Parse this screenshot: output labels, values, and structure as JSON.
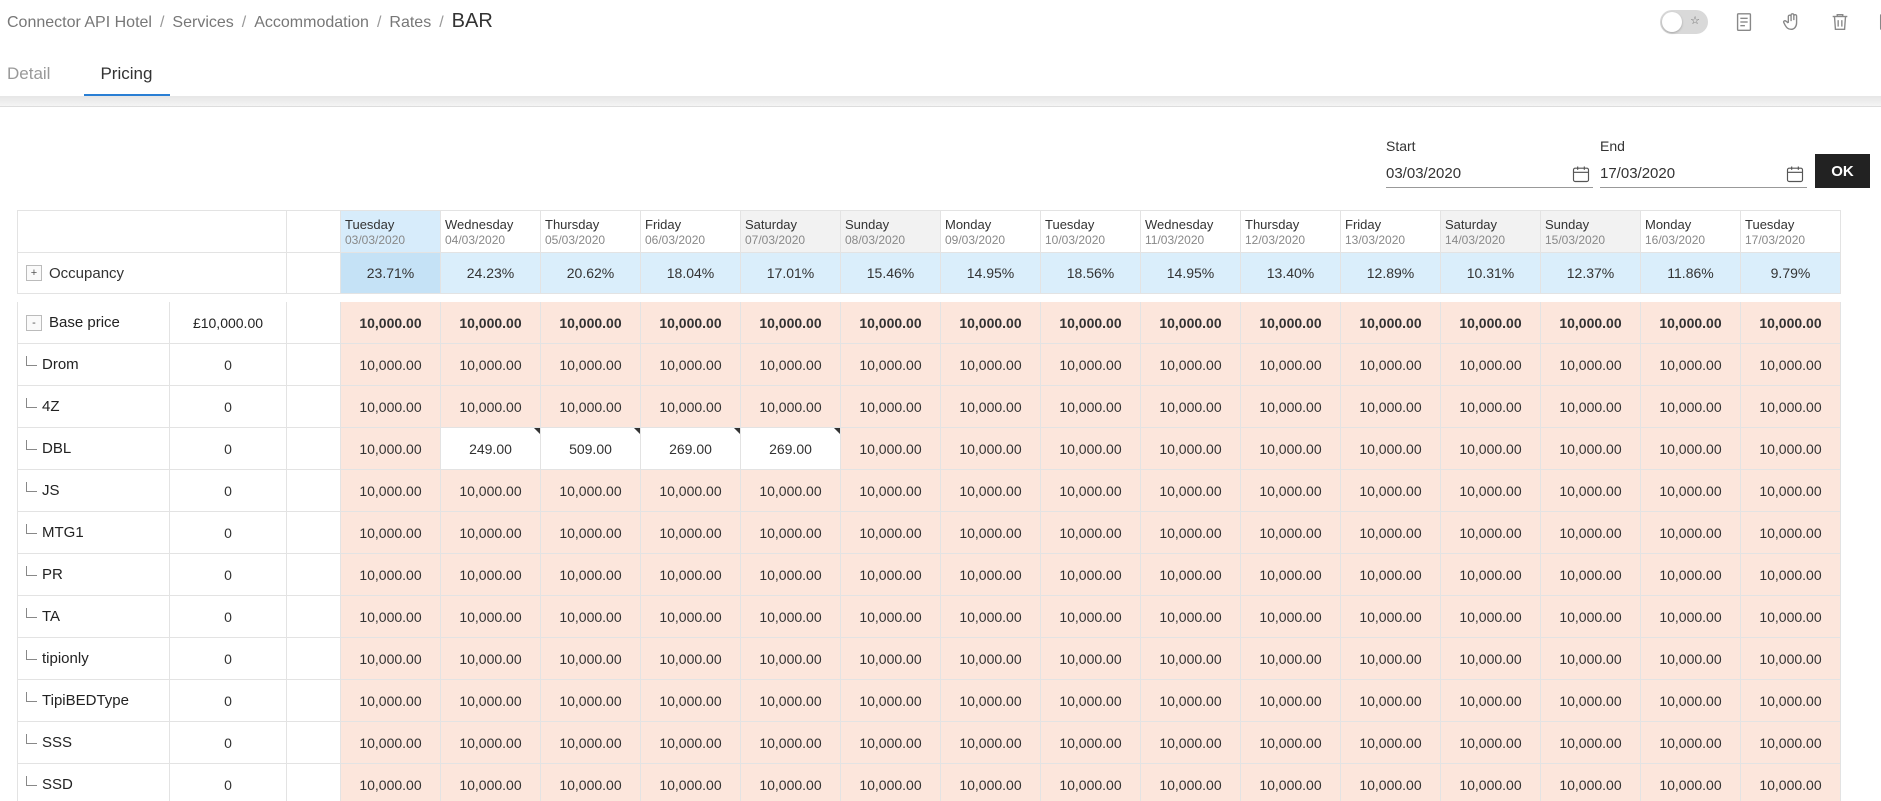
{
  "breadcrumb": {
    "items": [
      "Connector API Hotel",
      "Services",
      "Accommodation",
      "Rates"
    ],
    "current": "BAR"
  },
  "toolbar": {
    "toggle_icon": "star-icon",
    "icons": [
      "report-icon",
      "hand-icon",
      "trash-icon",
      "export-icon"
    ]
  },
  "tabs": [
    {
      "label": "Detail",
      "active": false
    },
    {
      "label": "Pricing",
      "active": true
    }
  ],
  "date_range": {
    "start_label": "Start",
    "start_value": "03/03/2020",
    "end_label": "End",
    "end_value": "17/03/2020",
    "ok_label": "OK"
  },
  "grid": {
    "days": [
      {
        "name": "Tuesday",
        "date": "03/03/2020",
        "kind": "today"
      },
      {
        "name": "Wednesday",
        "date": "04/03/2020",
        "kind": "normal"
      },
      {
        "name": "Thursday",
        "date": "05/03/2020",
        "kind": "normal"
      },
      {
        "name": "Friday",
        "date": "06/03/2020",
        "kind": "normal"
      },
      {
        "name": "Saturday",
        "date": "07/03/2020",
        "kind": "weekend"
      },
      {
        "name": "Sunday",
        "date": "08/03/2020",
        "kind": "weekend"
      },
      {
        "name": "Monday",
        "date": "09/03/2020",
        "kind": "normal"
      },
      {
        "name": "Tuesday",
        "date": "10/03/2020",
        "kind": "normal"
      },
      {
        "name": "Wednesday",
        "date": "11/03/2020",
        "kind": "normal"
      },
      {
        "name": "Thursday",
        "date": "12/03/2020",
        "kind": "normal"
      },
      {
        "name": "Friday",
        "date": "13/03/2020",
        "kind": "normal"
      },
      {
        "name": "Saturday",
        "date": "14/03/2020",
        "kind": "weekend"
      },
      {
        "name": "Sunday",
        "date": "15/03/2020",
        "kind": "weekend"
      },
      {
        "name": "Monday",
        "date": "16/03/2020",
        "kind": "normal"
      },
      {
        "name": "Tuesday",
        "date": "17/03/2020",
        "kind": "normal"
      }
    ],
    "occupancy": {
      "label": "Occupancy",
      "expander": "+",
      "values": [
        "23.71%",
        "24.23%",
        "20.62%",
        "18.04%",
        "17.01%",
        "15.46%",
        "14.95%",
        "18.56%",
        "14.95%",
        "13.40%",
        "12.89%",
        "10.31%",
        "12.37%",
        "11.86%",
        "9.79%"
      ]
    },
    "base_price": {
      "label": "Base price",
      "expander": "-",
      "base": "£10,000.00",
      "values": [
        "10,000.00",
        "10,000.00",
        "10,000.00",
        "10,000.00",
        "10,000.00",
        "10,000.00",
        "10,000.00",
        "10,000.00",
        "10,000.00",
        "10,000.00",
        "10,000.00",
        "10,000.00",
        "10,000.00",
        "10,000.00",
        "10,000.00"
      ]
    },
    "rows": [
      {
        "label": "Drom",
        "base": "0",
        "values": [
          "10,000.00",
          "10,000.00",
          "10,000.00",
          "10,000.00",
          "10,000.00",
          "10,000.00",
          "10,000.00",
          "10,000.00",
          "10,000.00",
          "10,000.00",
          "10,000.00",
          "10,000.00",
          "10,000.00",
          "10,000.00",
          "10,000.00"
        ],
        "overrides": []
      },
      {
        "label": "4Z",
        "base": "0",
        "values": [
          "10,000.00",
          "10,000.00",
          "10,000.00",
          "10,000.00",
          "10,000.00",
          "10,000.00",
          "10,000.00",
          "10,000.00",
          "10,000.00",
          "10,000.00",
          "10,000.00",
          "10,000.00",
          "10,000.00",
          "10,000.00",
          "10,000.00"
        ],
        "overrides": []
      },
      {
        "label": "DBL",
        "base": "0",
        "values": [
          "10,000.00",
          "249.00",
          "509.00",
          "269.00",
          "269.00",
          "10,000.00",
          "10,000.00",
          "10,000.00",
          "10,000.00",
          "10,000.00",
          "10,000.00",
          "10,000.00",
          "10,000.00",
          "10,000.00",
          "10,000.00"
        ],
        "overrides": [
          1,
          2,
          3,
          4
        ]
      },
      {
        "label": "JS",
        "base": "0",
        "values": [
          "10,000.00",
          "10,000.00",
          "10,000.00",
          "10,000.00",
          "10,000.00",
          "10,000.00",
          "10,000.00",
          "10,000.00",
          "10,000.00",
          "10,000.00",
          "10,000.00",
          "10,000.00",
          "10,000.00",
          "10,000.00",
          "10,000.00"
        ],
        "overrides": []
      },
      {
        "label": "MTG1",
        "base": "0",
        "values": [
          "10,000.00",
          "10,000.00",
          "10,000.00",
          "10,000.00",
          "10,000.00",
          "10,000.00",
          "10,000.00",
          "10,000.00",
          "10,000.00",
          "10,000.00",
          "10,000.00",
          "10,000.00",
          "10,000.00",
          "10,000.00",
          "10,000.00"
        ],
        "overrides": []
      },
      {
        "label": "PR",
        "base": "0",
        "values": [
          "10,000.00",
          "10,000.00",
          "10,000.00",
          "10,000.00",
          "10,000.00",
          "10,000.00",
          "10,000.00",
          "10,000.00",
          "10,000.00",
          "10,000.00",
          "10,000.00",
          "10,000.00",
          "10,000.00",
          "10,000.00",
          "10,000.00"
        ],
        "overrides": []
      },
      {
        "label": "TA",
        "base": "0",
        "values": [
          "10,000.00",
          "10,000.00",
          "10,000.00",
          "10,000.00",
          "10,000.00",
          "10,000.00",
          "10,000.00",
          "10,000.00",
          "10,000.00",
          "10,000.00",
          "10,000.00",
          "10,000.00",
          "10,000.00",
          "10,000.00",
          "10,000.00"
        ],
        "overrides": []
      },
      {
        "label": "tipionly",
        "base": "0",
        "values": [
          "10,000.00",
          "10,000.00",
          "10,000.00",
          "10,000.00",
          "10,000.00",
          "10,000.00",
          "10,000.00",
          "10,000.00",
          "10,000.00",
          "10,000.00",
          "10,000.00",
          "10,000.00",
          "10,000.00",
          "10,000.00",
          "10,000.00"
        ],
        "overrides": []
      },
      {
        "label": "TipiBEDType",
        "base": "0",
        "values": [
          "10,000.00",
          "10,000.00",
          "10,000.00",
          "10,000.00",
          "10,000.00",
          "10,000.00",
          "10,000.00",
          "10,000.00",
          "10,000.00",
          "10,000.00",
          "10,000.00",
          "10,000.00",
          "10,000.00",
          "10,000.00",
          "10,000.00"
        ],
        "overrides": []
      },
      {
        "label": "SSS",
        "base": "0",
        "values": [
          "10,000.00",
          "10,000.00",
          "10,000.00",
          "10,000.00",
          "10,000.00",
          "10,000.00",
          "10,000.00",
          "10,000.00",
          "10,000.00",
          "10,000.00",
          "10,000.00",
          "10,000.00",
          "10,000.00",
          "10,000.00",
          "10,000.00"
        ],
        "overrides": []
      },
      {
        "label": "SSD",
        "base": "0",
        "values": [
          "10,000.00",
          "10,000.00",
          "10,000.00",
          "10,000.00",
          "10,000.00",
          "10,000.00",
          "10,000.00",
          "10,000.00",
          "10,000.00",
          "10,000.00",
          "10,000.00",
          "10,000.00",
          "10,000.00",
          "10,000.00",
          "10,000.00"
        ],
        "overrides": []
      }
    ]
  },
  "colors": {
    "accent": "#2a7fd4",
    "occupancy_bg": "#daeefb",
    "price_bg": "#fce6dc",
    "weekend_header": "#f2f2f2"
  }
}
